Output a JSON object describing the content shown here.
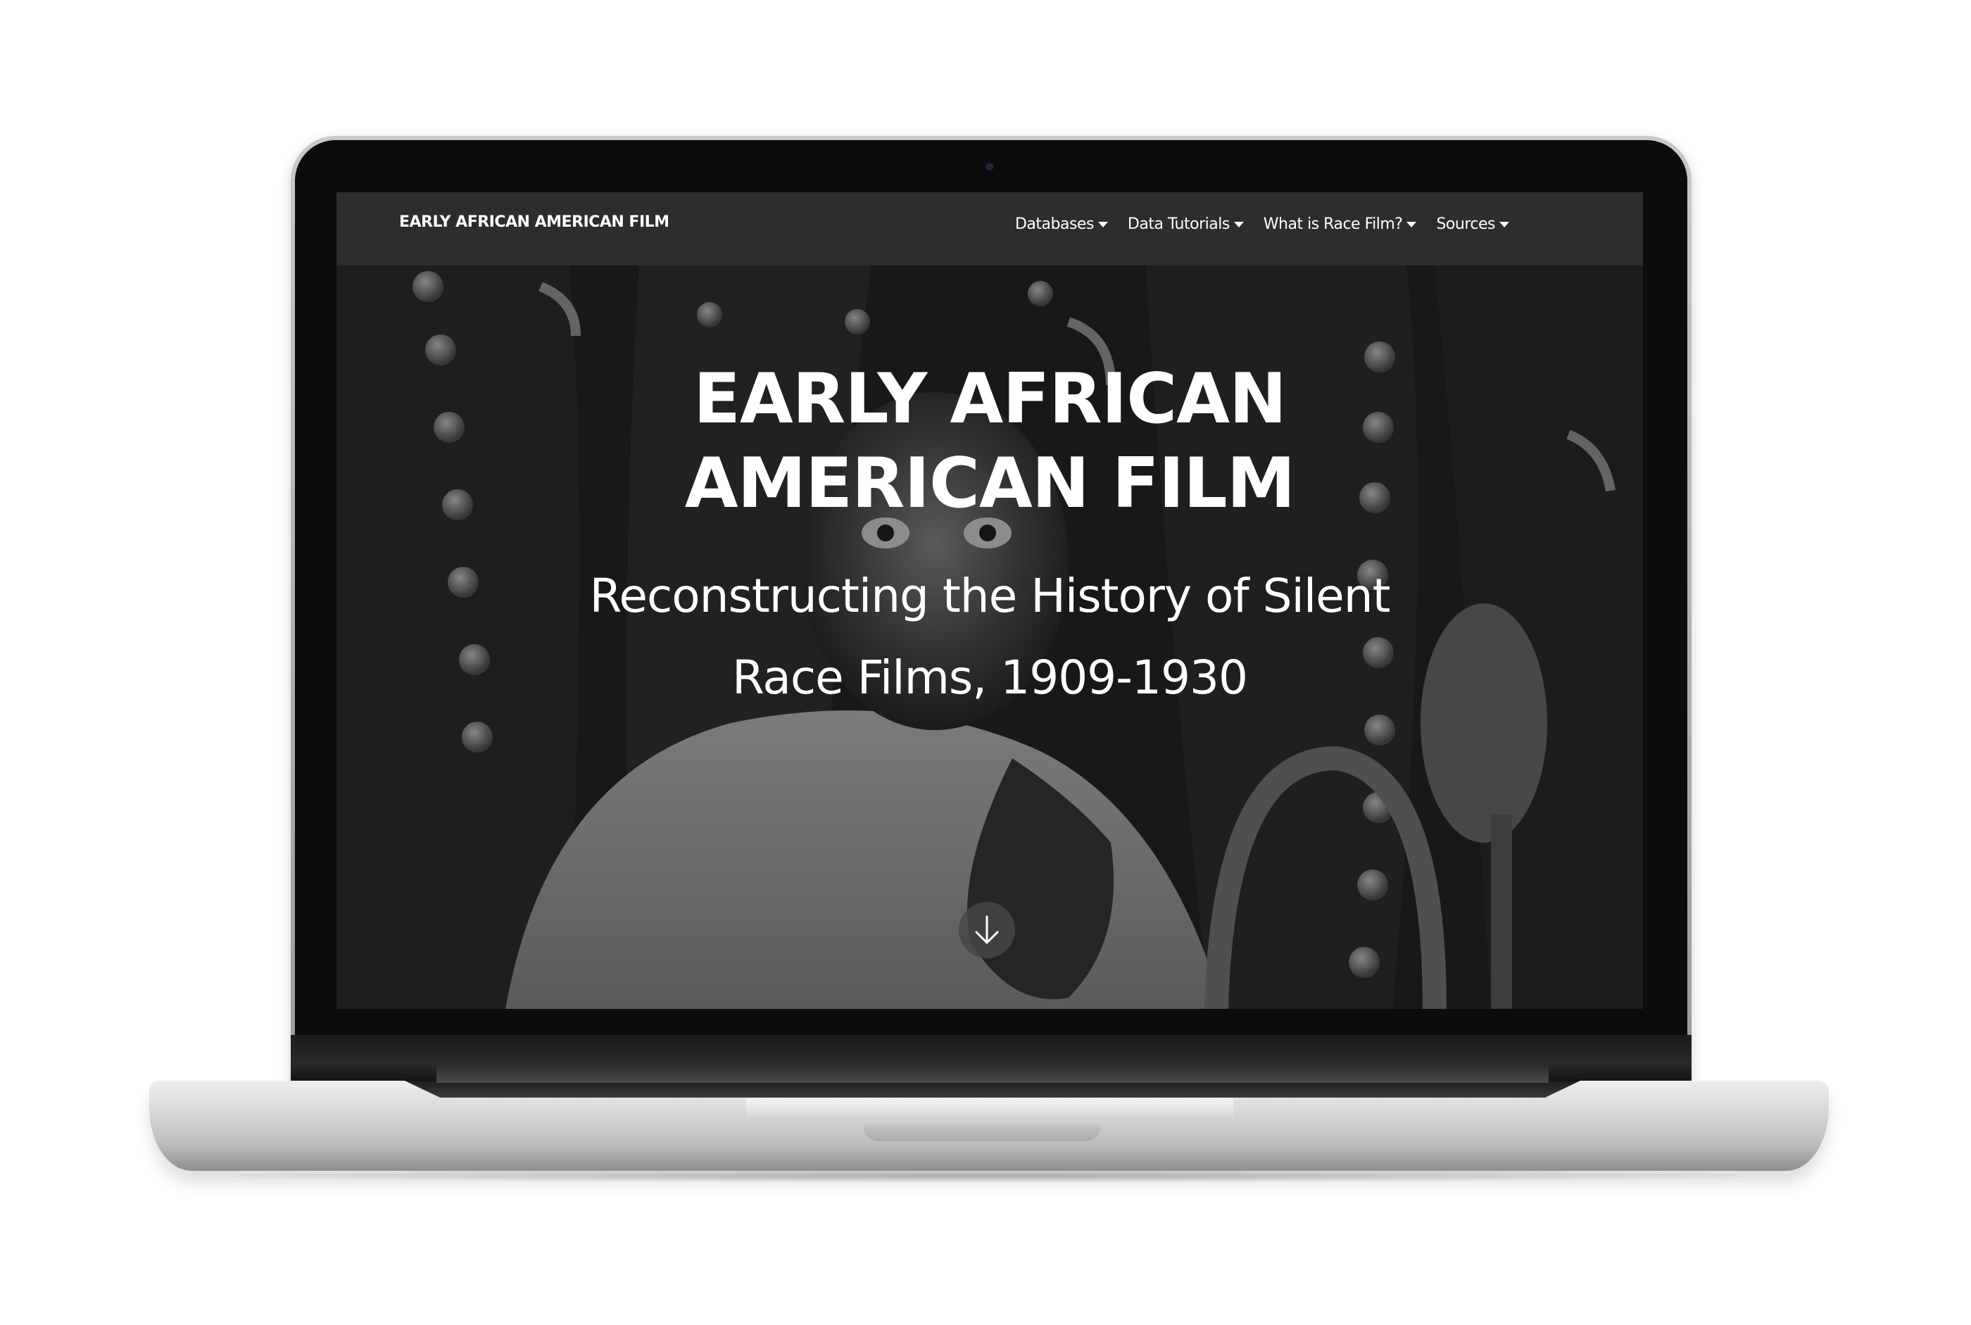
{
  "navbar": {
    "brand": "EARLY AFRICAN AMERICAN FILM",
    "items": [
      {
        "label": "Databases"
      },
      {
        "label": "Data Tutorials"
      },
      {
        "label": "What is Race Film?"
      },
      {
        "label": "Sources"
      }
    ]
  },
  "hero": {
    "title_line1": "EARLY AFRICAN",
    "title_line2": "AMERICAN FILM",
    "subtitle_line1": "Reconstructing the History of Silent",
    "subtitle_line2": "Race Films, 1909-1930",
    "scroll_icon": "arrow-down-icon"
  },
  "colors": {
    "navbar_bg": "#2d2d2e",
    "text": "#ffffff",
    "scroll_button_bg": "#464648"
  }
}
